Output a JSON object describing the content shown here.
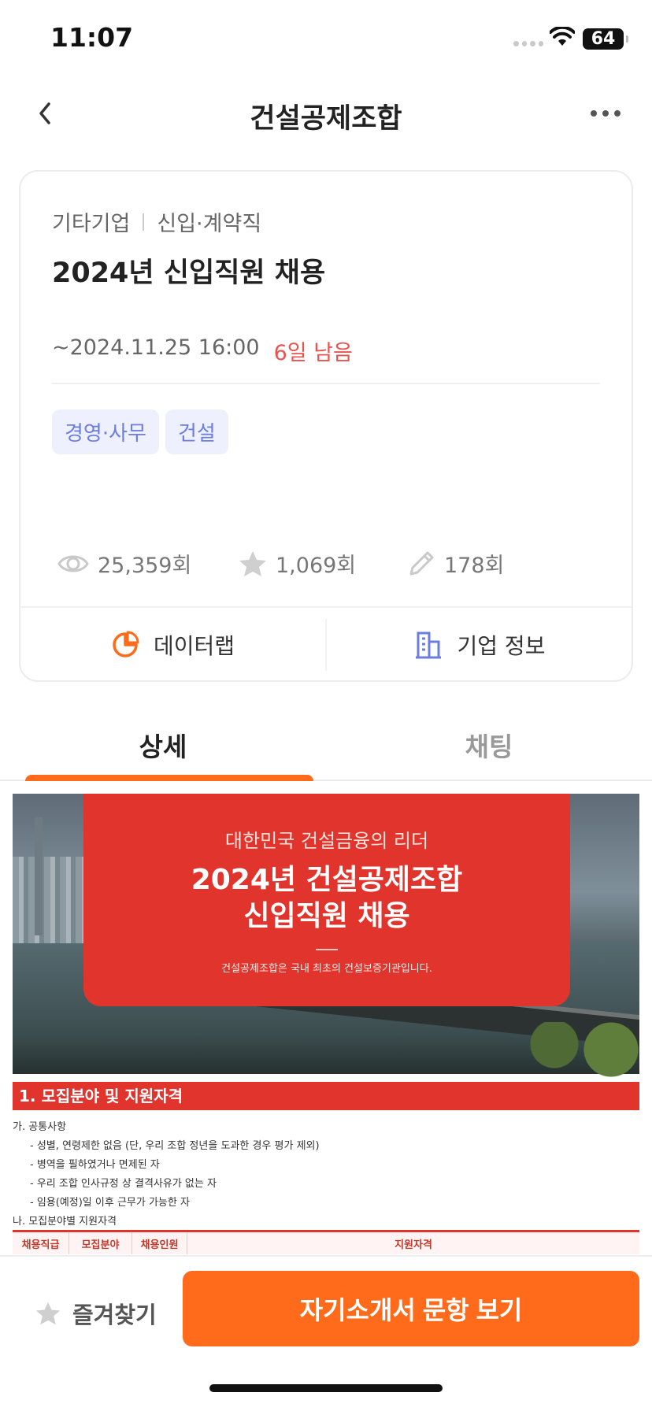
{
  "status_bar": {
    "time": "11:07",
    "battery": "64"
  },
  "navbar": {
    "title": "건설공제조합"
  },
  "job": {
    "company_type": "기타기업",
    "employment_type": "신입·계약직",
    "title": "2024년 신입직원 채용",
    "deadline": "~2024.11.25 16:00",
    "days_left": "6일 남음",
    "tags": [
      "경영·사무",
      "건설"
    ],
    "stats": {
      "views": "25,359회",
      "favorites": "1,069회",
      "writes": "178회"
    }
  },
  "card_actions": {
    "datalab": "데이터랩",
    "company_info": "기업 정보"
  },
  "tabs": [
    "상세",
    "채팅"
  ],
  "poster": {
    "slogan": "대한민국 건설금융의 리더",
    "headline_line1": "2024년 건설공제조합",
    "headline_line2": "신입직원 채용",
    "subtitle": "건설공제조합은 국내 최초의 건설보증기관입니다.",
    "section1_title": "1. 모집분야 및 지원자격",
    "common_heading": "가. 공통사항",
    "common_items": [
      "- 성별, 연령제한 없음 (단, 우리 조합 정년을 도과한 경우 평가 제외)",
      "- 병역을 필하였거나 면제된 자",
      "- 우리 조합 인사규정 상 결격사유가 없는 자",
      "- 임용(예정)일 이후 근무가 가능한 자"
    ],
    "field_heading": "나. 모집분야별 지원자격",
    "table_headers": [
      "채용직급",
      "모집분야",
      "채용인원",
      "지원자격"
    ]
  },
  "bottom_bar": {
    "favorite_label": "즐겨찾기",
    "cta_label": "자기소개서 문항 보기"
  },
  "colors": {
    "accent": "#ff6b1a",
    "deadline_red": "#e9534f",
    "tag_text": "#6b7de2",
    "poster_red": "#e0342d"
  }
}
